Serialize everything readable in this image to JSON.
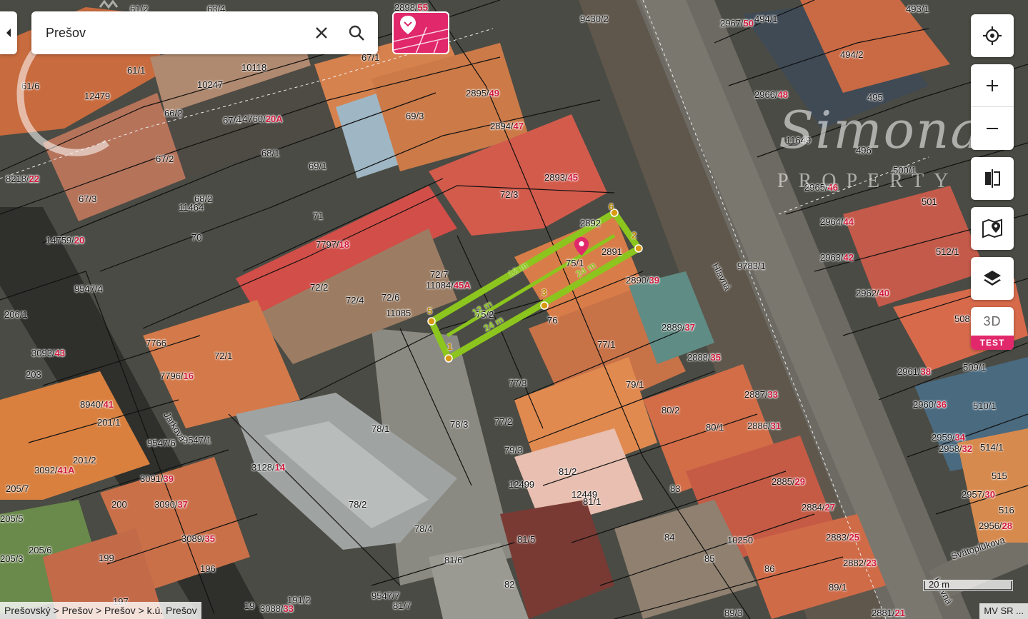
{
  "search": {
    "value": "Prešov"
  },
  "map": {
    "parcels": [
      {
        "num": "61/2"
      },
      {
        "num": "63/4"
      },
      {
        "num": "2898",
        "sub": "55"
      },
      {
        "num": "9430/2"
      },
      {
        "num": "2967",
        "sub": "50"
      },
      {
        "num": "494/1"
      },
      {
        "num": "493/1"
      },
      {
        "num": "61/6"
      },
      {
        "num": "61/1"
      },
      {
        "num": "10118"
      },
      {
        "num": "67/1"
      },
      {
        "num": "12479"
      },
      {
        "num": "10247"
      },
      {
        "num": "2895",
        "sub": "49"
      },
      {
        "num": "494/2"
      },
      {
        "num": "66/2"
      },
      {
        "num": "67/4"
      },
      {
        "num": "14760",
        "sub": "20A"
      },
      {
        "num": "69/3"
      },
      {
        "num": "2966",
        "sub": "48"
      },
      {
        "num": "495"
      },
      {
        "num": "68/1"
      },
      {
        "num": "2894",
        "sub": "47"
      },
      {
        "num": "11649"
      },
      {
        "num": "496"
      },
      {
        "num": "8218",
        "sub": "22"
      },
      {
        "num": "67/2"
      },
      {
        "num": "69/1"
      },
      {
        "num": "2893",
        "sub": "45"
      },
      {
        "num": "2965",
        "sub": "46"
      },
      {
        "num": "500/1"
      },
      {
        "num": "67/3"
      },
      {
        "num": "68/2"
      },
      {
        "num": "11464"
      },
      {
        "num": "72/3"
      },
      {
        "num": "501"
      },
      {
        "num": "71"
      },
      {
        "num": "2964",
        "sub": "44"
      },
      {
        "num": "14759",
        "sub": "20"
      },
      {
        "num": "70"
      },
      {
        "num": "7797",
        "sub": "18"
      },
      {
        "num": "2892"
      },
      {
        "num": "2891"
      },
      {
        "num": "512/1"
      },
      {
        "num": "75/1"
      },
      {
        "num": "9783/1"
      },
      {
        "num": "2963",
        "sub": "42"
      },
      {
        "num": "72/7"
      },
      {
        "num": "11084",
        "sub": "45A"
      },
      {
        "num": "2890",
        "sub": "39"
      },
      {
        "num": "9547/4"
      },
      {
        "num": "72/2"
      },
      {
        "num": "72/4"
      },
      {
        "num": "72/6"
      },
      {
        "num": "2962",
        "sub": "40"
      },
      {
        "num": "206/1"
      },
      {
        "num": "11085"
      },
      {
        "num": "75/2"
      },
      {
        "num": "76"
      },
      {
        "num": "508"
      },
      {
        "num": "7766"
      },
      {
        "num": "2889",
        "sub": "37"
      },
      {
        "num": "77/1"
      },
      {
        "num": "3093",
        "sub": "43"
      },
      {
        "num": "72/1"
      },
      {
        "num": "2888",
        "sub": "35"
      },
      {
        "num": "2961",
        "sub": "38"
      },
      {
        "num": "509/1"
      },
      {
        "num": "203"
      },
      {
        "num": "7796",
        "sub": "16"
      },
      {
        "num": "77/3"
      },
      {
        "num": "79/1"
      },
      {
        "num": "2887",
        "sub": "33"
      },
      {
        "num": "8940",
        "sub": "41"
      },
      {
        "num": "2960",
        "sub": "36"
      },
      {
        "num": "510/1"
      },
      {
        "num": "201/1"
      },
      {
        "num": "78/1"
      },
      {
        "num": "78/3"
      },
      {
        "num": "77/2"
      },
      {
        "num": "80/2"
      },
      {
        "num": "2886",
        "sub": "31"
      },
      {
        "num": "80/1"
      },
      {
        "num": "2959",
        "sub": "34"
      },
      {
        "num": "9547/6"
      },
      {
        "num": "9547/1"
      },
      {
        "num": "2958",
        "sub": "32"
      },
      {
        "num": "514/1"
      },
      {
        "num": "201/2"
      },
      {
        "num": "79/3"
      },
      {
        "num": "3092",
        "sub": "41A"
      },
      {
        "num": "3128",
        "sub": "14"
      },
      {
        "num": "81/2"
      },
      {
        "num": "3091",
        "sub": "39"
      },
      {
        "num": "515"
      },
      {
        "num": "12499"
      },
      {
        "num": "12449"
      },
      {
        "num": "83"
      },
      {
        "num": "2885",
        "sub": "29"
      },
      {
        "num": "205/7"
      },
      {
        "num": "81/1"
      },
      {
        "num": "2957",
        "sub": "30"
      },
      {
        "num": "200"
      },
      {
        "num": "3090",
        "sub": "37"
      },
      {
        "num": "78/2"
      },
      {
        "num": "2884",
        "sub": "27"
      },
      {
        "num": "516"
      },
      {
        "num": "205/5"
      },
      {
        "num": "78/4"
      },
      {
        "num": "84"
      },
      {
        "num": "2956",
        "sub": "28"
      },
      {
        "num": "3089",
        "sub": "35"
      },
      {
        "num": "81/5"
      },
      {
        "num": "10250"
      },
      {
        "num": "2883",
        "sub": "25"
      },
      {
        "num": "205/6"
      },
      {
        "num": "199"
      },
      {
        "num": "85"
      },
      {
        "num": "205/3"
      },
      {
        "num": "196"
      },
      {
        "num": "81/6"
      },
      {
        "num": "86"
      },
      {
        "num": "2882",
        "sub": "23"
      },
      {
        "num": "82"
      },
      {
        "num": "89/1"
      },
      {
        "num": "9547/7"
      },
      {
        "num": "191/2"
      },
      {
        "num": "197"
      },
      {
        "num": "19"
      },
      {
        "num": "3088",
        "sub": "33"
      },
      {
        "num": "81/7"
      },
      {
        "num": "89/3"
      },
      {
        "num": "2881",
        "sub": "21"
      }
    ],
    "streets": [
      "Hlavná",
      "Jarková",
      "Svätoplukova",
      "Hlavná"
    ],
    "selection": {
      "vertices": [
        "1",
        "2",
        "3",
        "4",
        "5",
        "6"
      ],
      "distances": [
        "24 m",
        "24 m",
        "12 m",
        "12 m"
      ],
      "marker": "pin-icon"
    }
  },
  "watermark": {
    "brand": "Simona",
    "sub": "PROPERTY"
  },
  "controls": {
    "three_d_label": "3D",
    "three_d_badge": "TEST"
  },
  "breadcrumb": "Prešovský > Prešov > Prešov > k.ú. Prešov",
  "scale": {
    "label": "20 m"
  },
  "attribution": "MV SR ...",
  "colors": {
    "accent": "#e0286b",
    "selection": "#8cc51e",
    "parcel_sub": "#d01a3c"
  }
}
